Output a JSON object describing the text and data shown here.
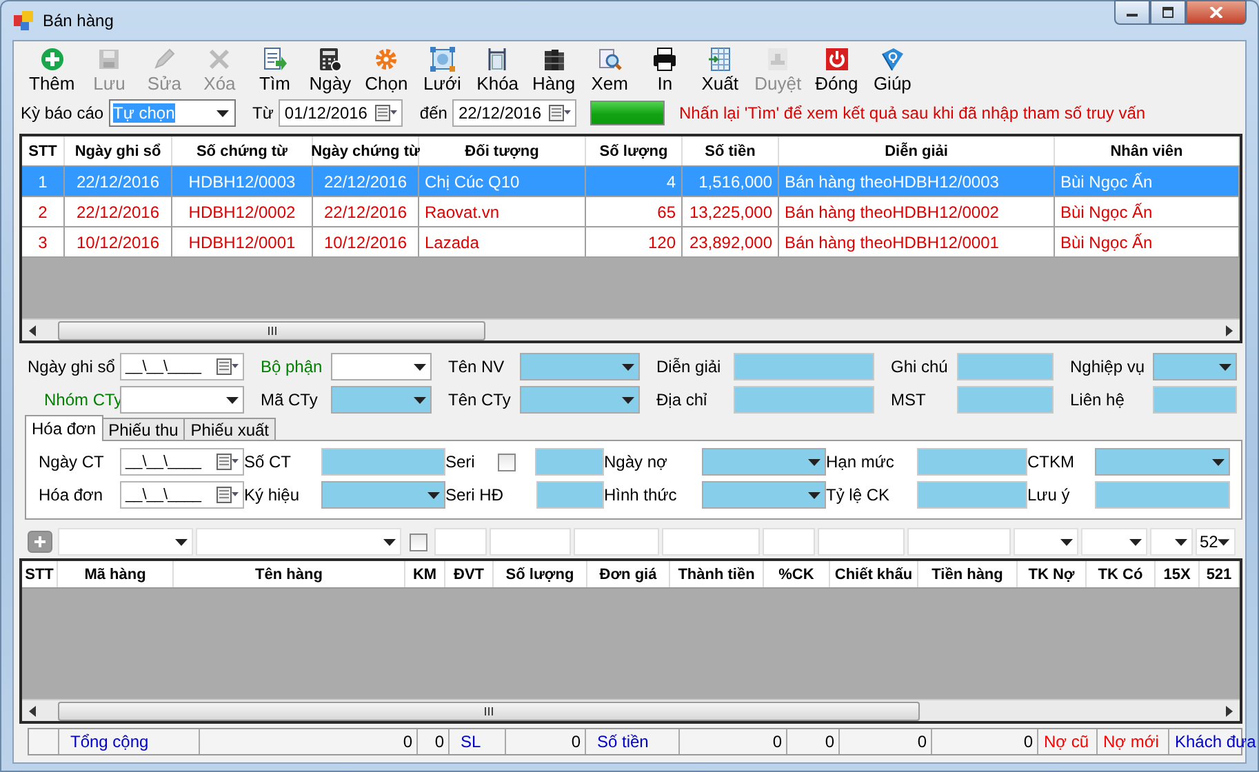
{
  "window": {
    "title": "Bán hàng"
  },
  "toolbar": [
    {
      "label": "Thêm",
      "disabled": false
    },
    {
      "label": "Lưu",
      "disabled": true
    },
    {
      "label": "Sửa",
      "disabled": true
    },
    {
      "label": "Xóa",
      "disabled": true
    },
    {
      "label": "Tìm",
      "disabled": false
    },
    {
      "label": "Ngày",
      "disabled": false
    },
    {
      "label": "Chọn",
      "disabled": false
    },
    {
      "label": "Lưới",
      "disabled": false
    },
    {
      "label": "Khóa",
      "disabled": false
    },
    {
      "label": "Hàng",
      "disabled": false
    },
    {
      "label": "Xem",
      "disabled": false
    },
    {
      "label": "In",
      "disabled": false
    },
    {
      "label": "Xuất",
      "disabled": false
    },
    {
      "label": "Duyệt",
      "disabled": true
    },
    {
      "label": "Đóng",
      "disabled": false
    },
    {
      "label": "Giúp",
      "disabled": false
    }
  ],
  "query": {
    "period_label": "Kỳ báo cáo",
    "period": {
      "value": "Tự chọn",
      "highlighted": true
    },
    "from_label": "Từ",
    "from": "01/12/2016",
    "to_label": "đến",
    "to": "22/12/2016",
    "progress": {
      "level": 1
    },
    "hint": "Nhấn lại 'Tìm' để xem kết quả sau khi đã nhập tham số truy vấn"
  },
  "vouchers": {
    "columns": [
      "STT",
      "Ngày ghi sổ",
      "Số chứng từ",
      "Ngày chứng từ",
      "Đối tượng",
      "Số lượng",
      "Số tiền",
      "Diễn giải",
      "Nhân viên"
    ],
    "rows": [
      {
        "selected": true,
        "cells": [
          "1",
          "22/12/2016",
          "HDBH12/0003",
          "22/12/2016",
          "Chị Cúc Q10",
          "4",
          "1,516,000",
          "Bán hàng theoHDBH12/0003",
          "Bùi Ngọc Ấn"
        ]
      },
      {
        "selected": false,
        "cells": [
          "2",
          "22/12/2016",
          "HDBH12/0002",
          "22/12/2016",
          "Raovat.vn",
          "65",
          "13,225,000",
          "Bán hàng theoHDBH12/0002",
          "Bùi Ngọc Ấn"
        ]
      },
      {
        "selected": false,
        "cells": [
          "3",
          "10/12/2016",
          "HDBH12/0001",
          "10/12/2016",
          "Lazada",
          "120",
          "23,892,000",
          "Bán hàng theoHDBH12/0001",
          "Bùi Ngọc Ấn"
        ]
      }
    ]
  },
  "header_fields": [
    {
      "label": "Ngày ghi sổ",
      "required": false,
      "kind": "date",
      "value": "__\\__\\____"
    },
    {
      "label": "Bộ phận",
      "required": true,
      "kind": "combo"
    },
    {
      "label": "Tên NV",
      "required": false,
      "kind": "combo",
      "color": "#87ceeb"
    },
    {
      "label": "Diễn giải",
      "required": false,
      "kind": "text",
      "color": "#87ceeb"
    },
    {
      "label": "Ghi chú",
      "required": false,
      "kind": "text",
      "color": "#87ceeb"
    },
    {
      "label": "Nghiệp vụ",
      "required": false,
      "kind": "combo",
      "color": "#87ceeb"
    },
    {
      "label": "Nhóm CTy",
      "required": true,
      "kind": "combo"
    },
    {
      "label": "Mã CTy",
      "required": false,
      "kind": "combo",
      "color": "#87ceeb"
    },
    {
      "label": "Tên CTy",
      "required": false,
      "kind": "combo",
      "color": "#87ceeb"
    },
    {
      "label": "Địa chỉ",
      "required": false,
      "kind": "text",
      "color": "#87ceeb"
    },
    {
      "label": "MST",
      "required": false,
      "kind": "text",
      "color": "#87ceeb"
    },
    {
      "label": "Liên hệ",
      "required": false,
      "kind": "text",
      "color": "#87ceeb"
    }
  ],
  "tabs": [
    {
      "label": "Hóa đơn",
      "selected": true
    },
    {
      "label": "Phiếu thu",
      "selected": false
    },
    {
      "label": "Phiếu xuất",
      "selected": false
    }
  ],
  "invoice_fields": [
    {
      "label": "Ngày CT",
      "kind": "date",
      "value": "__\\__\\____"
    },
    {
      "label": "Số CT",
      "kind": "text",
      "color": "#87ceeb"
    },
    {
      "label": "Seri",
      "kind": "check-text",
      "checked": false,
      "color": "#87ceeb"
    },
    {
      "label": "Ngày nợ",
      "kind": "combo",
      "color": "#87ceeb"
    },
    {
      "label": "Hạn mức",
      "kind": "text",
      "color": "#87ceeb"
    },
    {
      "label": "CTKM",
      "kind": "combo",
      "color": "#87ceeb"
    },
    {
      "label": "Hóa đơn",
      "kind": "date",
      "value": "__\\__\\____"
    },
    {
      "label": "Ký hiệu",
      "kind": "combo",
      "color": "#87ceeb"
    },
    {
      "label": "Seri HĐ",
      "kind": "text",
      "color": "#87ceeb"
    },
    {
      "label": "Hình thức",
      "kind": "combo",
      "color": "#87ceeb"
    },
    {
      "label": "Tỷ lệ CK",
      "kind": "text",
      "color": "#87ceeb"
    },
    {
      "label": "Lưu ý",
      "kind": "text",
      "color": "#87ceeb"
    }
  ],
  "filter_row": [
    {
      "kind": "add"
    },
    {
      "kind": "combo"
    },
    {
      "kind": "combo"
    },
    {
      "kind": "check",
      "checked": false
    },
    {
      "kind": "text"
    },
    {
      "kind": "text"
    },
    {
      "kind": "text"
    },
    {
      "kind": "text"
    },
    {
      "kind": "text"
    },
    {
      "kind": "text"
    },
    {
      "kind": "text"
    },
    {
      "kind": "combo"
    },
    {
      "kind": "combo"
    },
    {
      "kind": "combo"
    },
    {
      "kind": "combo",
      "value": "52"
    }
  ],
  "items": {
    "columns": [
      "STT",
      "Mã hàng",
      "Tên hàng",
      "KM",
      "ĐVT",
      "Số lượng",
      "Đơn giá",
      "Thành tiền",
      "%CK",
      "Chiết khấu",
      "Tiền hàng",
      "TK Nợ",
      "TK Có",
      "15X",
      "521"
    ]
  },
  "totals": [
    {
      "text": "Tổng cộng",
      "color": "#0000cc"
    },
    {
      "text": "0",
      "color": "#000000"
    },
    {
      "text": "0",
      "color": "#000000"
    },
    {
      "text": "SL",
      "color": "#0000cc"
    },
    {
      "text": "0",
      "color": "#000000"
    },
    {
      "text": "Số tiền",
      "color": "#0000cc"
    },
    {
      "text": "0",
      "color": "#000000"
    },
    {
      "text": "0",
      "color": "#000000"
    },
    {
      "text": "0",
      "color": "#000000"
    },
    {
      "text": "0",
      "color": "#000000"
    },
    {
      "text": "Nợ cũ",
      "color": "#ff0000"
    },
    {
      "text": "Nợ mới",
      "color": "#ff0000"
    },
    {
      "text": "Khách đưa",
      "color": "#0000cc"
    }
  ]
}
